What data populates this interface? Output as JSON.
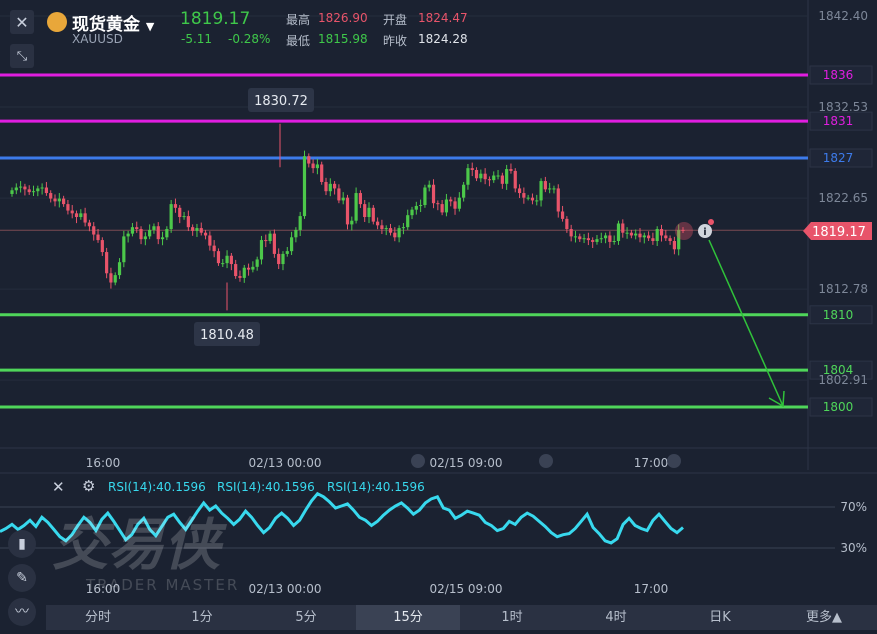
{
  "header": {
    "instrument_name": "现货黄金",
    "symbol": "XAUUSD",
    "last_price": "1819.17",
    "change": "-5.11",
    "change_pct": "-0.28%",
    "high_label": "最高",
    "high_value": "1826.90",
    "open_label": "开盘",
    "open_value": "1824.47",
    "low_label": "最低",
    "low_value": "1815.98",
    "prev_close_label": "昨收",
    "prev_close_value": "1824.28"
  },
  "colors": {
    "background": "#1b2231",
    "up": "#4cc84a",
    "down": "#e8546a",
    "magenta_line": "#e01ee0",
    "blue_line": "#3d7bea",
    "green_line": "#4fd65a",
    "rsi_line": "#38d9ee",
    "price_tag": "#e8546a",
    "arrow": "#30c23a"
  },
  "chart_data": [
    {
      "type": "candlestick",
      "title": "",
      "y_axis_ticks": [
        "1842.40",
        "1832.53",
        "1822.65",
        "1812.78",
        "1802.91"
      ],
      "x_axis_ticks": [
        "16:00",
        "02/13 00:00",
        "02/15 09:00",
        "17:00"
      ],
      "ylim": [
        1799,
        1843
      ],
      "last_price_tag": "1819.17",
      "annotations": {
        "max": "1830.72",
        "min": "1810.48"
      },
      "horizontal_lines": [
        {
          "value": 1836,
          "label": "1836",
          "color": "#e01ee0"
        },
        {
          "value": 1831,
          "label": "1831",
          "color": "#e01ee0"
        },
        {
          "value": 1827,
          "label": "1827",
          "color": "#3d7bea"
        },
        {
          "value": 1810,
          "label": "1810",
          "color": "#4fd65a"
        },
        {
          "value": 1804,
          "label": "1804",
          "color": "#4fd65a"
        },
        {
          "value": 1800,
          "label": "1800",
          "color": "#4fd65a"
        }
      ],
      "close": [
        1823.5,
        1823.8,
        1823.9,
        1823.6,
        1823.3,
        1823.4,
        1823.7,
        1823.8,
        1823.2,
        1822.6,
        1822.3,
        1822.6,
        1822.0,
        1821.3,
        1821.0,
        1820.6,
        1821.0,
        1820.0,
        1819.6,
        1818.7,
        1818.1,
        1816.8,
        1814.5,
        1813.5,
        1814.3,
        1815.7,
        1818.5,
        1818.8,
        1819.5,
        1819.3,
        1818.2,
        1818.5,
        1819.2,
        1819.6,
        1818.2,
        1818.4,
        1819.3,
        1822.0,
        1821.6,
        1820.6,
        1820.7,
        1819.5,
        1819.1,
        1819.4,
        1818.9,
        1818.6,
        1817.5,
        1816.9,
        1815.6,
        1815.6,
        1816.4,
        1815.5,
        1814.2,
        1814.0,
        1815.1,
        1814.9,
        1815.2,
        1816.0,
        1818.1,
        1818.0,
        1818.8,
        1816.6,
        1815.5,
        1816.6,
        1816.9,
        1818.4,
        1819.2,
        1820.7,
        1827.2,
        1826.4,
        1825.9,
        1826.3,
        1824.4,
        1823.4,
        1824.2,
        1823.7,
        1822.4,
        1822.7,
        1819.8,
        1820.2,
        1823.2,
        1822.0,
        1820.6,
        1821.6,
        1820.1,
        1819.7,
        1819.3,
        1819.4,
        1818.9,
        1818.4,
        1819.4,
        1819.5,
        1820.8,
        1821.4,
        1821.8,
        1821.9,
        1823.8,
        1824.1,
        1822.1,
        1822.0,
        1821.1,
        1822.5,
        1822.3,
        1821.5,
        1822.7,
        1824.1,
        1825.9,
        1825.7,
        1824.8,
        1825.3,
        1824.7,
        1824.6,
        1825.1,
        1825.1,
        1824.2,
        1825.8,
        1825.6,
        1823.7,
        1823.2,
        1822.7,
        1822.7,
        1822.4,
        1822.4,
        1824.5,
        1823.6,
        1823.7,
        1823.7,
        1821.2,
        1820.4,
        1819.3,
        1818.5,
        1818.5,
        1818.2,
        1818.3,
        1818.1,
        1817.9,
        1818.2,
        1818.3,
        1818.6,
        1817.9,
        1818.0,
        1819.9,
        1818.9,
        1818.9,
        1818.6,
        1818.8,
        1818.4,
        1818.6,
        1818.3,
        1818.0,
        1819.3,
        1818.6,
        1818.3,
        1818.0,
        1817.1,
        1819.2,
        1819.17
      ],
      "open": [
        1823.1,
        1823.5,
        1823.8,
        1823.9,
        1823.6,
        1823.3,
        1823.4,
        1823.7,
        1823.8,
        1823.2,
        1822.6,
        1822.3,
        1822.6,
        1822.0,
        1821.3,
        1821.0,
        1820.6,
        1821.0,
        1820.0,
        1819.6,
        1818.7,
        1818.1,
        1816.8,
        1814.5,
        1813.5,
        1814.3,
        1815.7,
        1818.5,
        1818.8,
        1819.5,
        1819.3,
        1818.2,
        1818.5,
        1819.2,
        1819.6,
        1818.2,
        1818.4,
        1819.3,
        1822.0,
        1821.6,
        1820.6,
        1820.7,
        1819.5,
        1819.1,
        1819.4,
        1818.9,
        1818.6,
        1817.5,
        1816.9,
        1815.6,
        1815.6,
        1816.4,
        1815.5,
        1814.2,
        1814.0,
        1815.1,
        1814.9,
        1815.2,
        1816.0,
        1818.1,
        1818.0,
        1818.8,
        1816.6,
        1815.5,
        1816.6,
        1816.9,
        1818.4,
        1819.2,
        1820.7,
        1827.2,
        1826.4,
        1825.9,
        1826.3,
        1824.4,
        1823.4,
        1824.2,
        1823.7,
        1822.4,
        1822.7,
        1819.8,
        1820.2,
        1823.2,
        1822.0,
        1820.6,
        1821.6,
        1820.1,
        1819.7,
        1819.3,
        1819.4,
        1818.9,
        1818.4,
        1819.4,
        1819.5,
        1820.8,
        1821.4,
        1821.8,
        1821.9,
        1823.8,
        1824.1,
        1822.1,
        1822.0,
        1821.1,
        1822.5,
        1822.3,
        1821.5,
        1822.7,
        1824.1,
        1825.9,
        1825.7,
        1824.8,
        1825.3,
        1824.7,
        1824.6,
        1825.1,
        1825.1,
        1824.2,
        1825.8,
        1825.6,
        1823.7,
        1823.2,
        1822.7,
        1822.7,
        1822.4,
        1822.4,
        1824.5,
        1823.6,
        1823.7,
        1823.7,
        1821.2,
        1820.4,
        1819.3,
        1818.5,
        1818.5,
        1818.2,
        1818.3,
        1818.1,
        1817.9,
        1818.2,
        1818.3,
        1818.6,
        1817.9,
        1818.0,
        1819.9,
        1818.9,
        1818.9,
        1818.6,
        1818.8,
        1818.4,
        1818.6,
        1818.3,
        1818.0,
        1819.3,
        1818.6,
        1818.3,
        1818.0,
        1817.1,
        1819.2
      ]
    },
    {
      "type": "line",
      "title": "",
      "series": [
        {
          "name": "RSI(14):40.1596",
          "values": [
            46,
            49,
            53,
            48,
            52,
            57,
            51,
            60,
            55,
            48,
            41,
            37,
            43,
            52,
            60,
            55,
            47,
            58,
            64,
            56,
            47,
            38,
            43,
            53,
            59,
            48,
            42,
            51,
            60,
            63,
            55,
            48,
            57,
            66,
            74,
            67,
            71,
            64,
            59,
            53,
            58,
            66,
            60,
            52,
            45,
            50,
            59,
            64,
            59,
            52,
            57,
            67,
            76,
            83,
            80,
            75,
            69,
            71,
            73,
            67,
            60,
            57,
            52,
            56,
            62,
            67,
            71,
            74,
            69,
            63,
            67,
            74,
            78,
            80,
            69,
            67,
            59,
            62,
            66,
            64,
            62,
            55,
            52,
            47,
            49,
            56,
            53,
            60,
            64,
            61,
            56,
            51,
            45,
            41,
            43,
            44,
            49,
            56,
            63,
            50,
            44,
            37,
            35,
            39,
            53,
            59,
            52,
            49,
            47,
            57,
            63,
            56,
            49,
            45,
            50
          ]
        }
      ],
      "y_axis_ticks": [
        "70%",
        "30%"
      ],
      "ylim": [
        15,
        88
      ],
      "x_axis_ticks": [
        "16:00",
        "02/13 00:00",
        "02/15 09:00",
        "17:00"
      ]
    }
  ],
  "indicator_bar": {
    "labels": [
      "RSI(14):40.1596",
      "RSI(14):40.1596",
      "RSI(14):40.1596"
    ]
  },
  "watermark": {
    "text_cn": "交易侠",
    "text_en": "TRADER MASTER"
  },
  "timeframe_tabs": [
    "分时",
    "1分",
    "5分",
    "15分",
    "1时",
    "4时",
    "日K",
    "更多▲"
  ],
  "active_tab": "15分"
}
